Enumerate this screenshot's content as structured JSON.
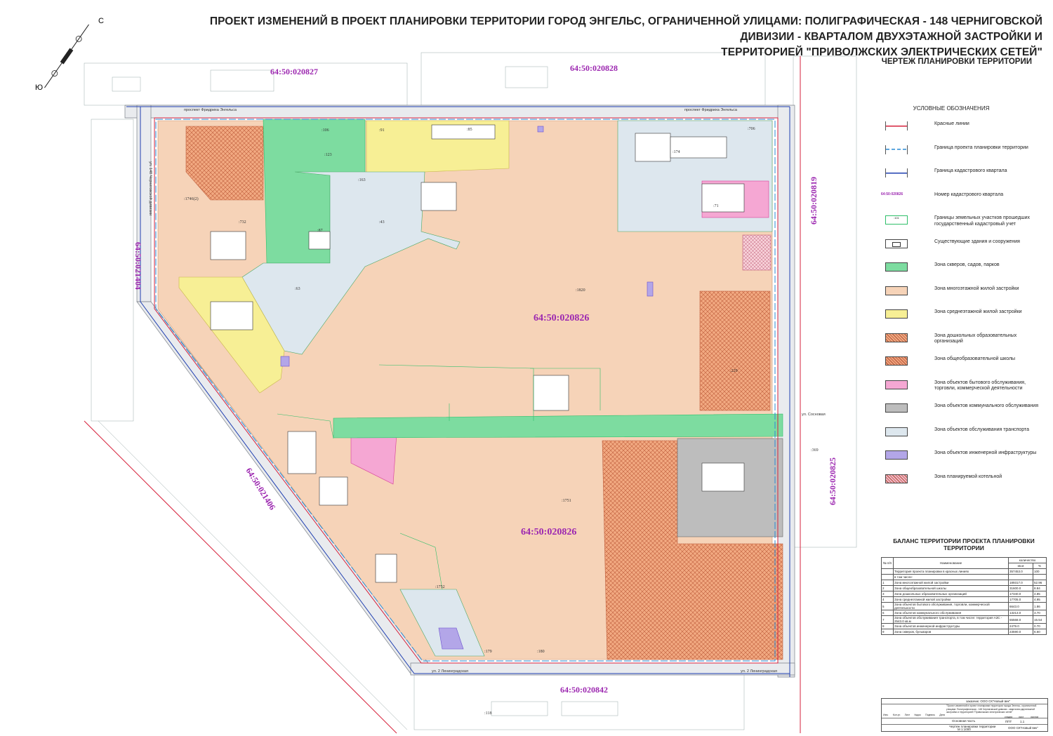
{
  "title": {
    "line1": "ПРОЕКТ ИЗМЕНЕНИЙ В ПРОЕКТ ПЛАНИРОВКИ ТЕРРИТОРИИ ГОРОД ЭНГЕЛЬС, ОГРАНИЧЕННОЙ УЛИЦАМИ: ПОЛИГРАФИЧЕСКАЯ - 148 ЧЕРНИГОВСКОЙ ДИВИЗИИ - КВАРТАЛОМ ДВУХЭТАЖНОЙ ЗАСТРОЙКИ И",
    "line2": "ТЕРРИТОРИЕЙ \"ПРИВОЛЖСКИХ ЭЛЕКТРИЧЕСКИХ СЕТЕЙ\"",
    "subtitle": "ЧЕРТЕЖ ПЛАНИРОВКИ ТЕРРИТОРИИ"
  },
  "compass": {
    "north": "С",
    "south": "Ю"
  },
  "colors": {
    "red_line": "#d6223c",
    "project_boundary": "#2a8bd4",
    "cadastral_boundary": "#1f3fb0",
    "cadastral_number": "#9c27b0",
    "green_zone": "#7ddca0",
    "multistorey": "#f6d3b8",
    "midrise": "#f7ef95",
    "preschool": "#f2a981",
    "school": "#f0a07a",
    "commercial": "#f5a7d3",
    "communal": "#bdbdbd",
    "transport": "#dde7ee",
    "engineering": "#b3a6e8",
    "boiler": "#f3b4c6"
  },
  "cadastral_labels": {
    "center_north": "64:50:020826",
    "center_south": "64:50:020826",
    "top_left": "64:50:020827",
    "top_right": "64:50:020828",
    "left": "64:50:021404",
    "right_top": "64:50:020819",
    "right_bottom": "64:50:020825",
    "bottom": "64:50:020842",
    "diagonal": "64:50:021406"
  },
  "parcel_labels": {
    "p1820": ":1820",
    "p1751": ":1751",
    "p1752": ":1752",
    "p1746": ":1746(2)",
    "p106": ":106",
    "p123": ":123",
    "p91": ":91",
    "p85": ":85",
    "p706": ":706",
    "p174": ":174",
    "p71": ":71",
    "p163": ":163",
    "p43": ":43",
    "p87": ":87",
    "p732": ":732",
    "p229": ":229",
    "p369": ":369",
    "p118": ":118",
    "p180": ":180",
    "p179": ":179",
    "p63": ":63"
  },
  "streets": {
    "top": "проспект Фридриха Энгельса",
    "bottom": "ул. 2 Ленинградская",
    "left": "ул. 148 Черниговской дивизии",
    "right": "ул. Сосновая"
  },
  "legend": {
    "heading": "УСЛОВНЫЕ ОБОЗНАЧЕНИЯ",
    "sample_cadastral": "64:50:020826",
    "sample_parcel": ":101",
    "items": [
      {
        "label": "Красные  линии",
        "type": "line",
        "color": "#d6223c"
      },
      {
        "label": "Граница проекта планировки территории",
        "type": "dash",
        "color": "#2a8bd4"
      },
      {
        "label": "Граница кадастрового квартала",
        "type": "line",
        "color": "#1f3fb0"
      },
      {
        "label": "Номер кадастрового квартала",
        "type": "text",
        "color": "#9c27b0"
      },
      {
        "label": "Границы земельных участков прошедших государственный кадастровый учет",
        "type": "parcel",
        "color": "#2fbf6a"
      },
      {
        "label": "Существующие здания и сооружения",
        "type": "building",
        "color": "#ffffff"
      },
      {
        "label": "Зона скверов, садов, парков",
        "type": "fill",
        "color": "#7ddca0"
      },
      {
        "label": "Зона многоэтажной жилой застройки",
        "type": "fill",
        "color": "#f6d3b8"
      },
      {
        "label": "Зона среднеэтажной жилой застройки",
        "type": "fill",
        "color": "#f7ef95"
      },
      {
        "label": "Зона дошкольных образовательных организаций",
        "type": "hatch",
        "color": "#f2a981"
      },
      {
        "label": "Зона общеобразовательной школы",
        "type": "hatch",
        "color": "#f0a07a"
      },
      {
        "label": "Зона объектов бытового обслуживания, торговли, коммерческой деятельности",
        "type": "fill",
        "color": "#f5a7d3"
      },
      {
        "label": "Зона объектов коммунального обслуживания",
        "type": "fill",
        "color": "#bdbdbd"
      },
      {
        "label": "Зона объектов обслуживания транспорта",
        "type": "fill",
        "color": "#dde7ee"
      },
      {
        "label": "Зона объектов инженерной инфраструктуры",
        "type": "fill",
        "color": "#b3a6e8"
      },
      {
        "label": "Зона планируемой котельной",
        "type": "hatch",
        "color": "#f3b4c6"
      }
    ]
  },
  "balance": {
    "title": "БАЛАНС ТЕРРИТОРИИ ПРОЕКТА ПЛАНИРОВКИ ТЕРРИТОРИИ",
    "headers": {
      "num": "№ п/п",
      "name": "Наименование",
      "qty": "количество",
      "unit1": "кв.м",
      "unit2": "%"
    },
    "total": {
      "name": "Территория проекта планировки в красных линиях",
      "area": "357453.0",
      "pct": "100"
    },
    "sub": "в том числе:",
    "rows": [
      {
        "n": "1",
        "name": "Зона многоэтажной жилой застройки",
        "area": "189317.0",
        "pct": "52.96"
      },
      {
        "n": "2",
        "name": "Зона общеобразовательной школы",
        "area": "31600.0",
        "pct": "8.84"
      },
      {
        "n": "3",
        "name": "Зона дошкольных образовательных организаций",
        "area": "17340.0",
        "pct": "4.85"
      },
      {
        "n": "4",
        "name": "Зона среднеэтажной жилой застройки",
        "area": "17705.0",
        "pct": "4.95"
      },
      {
        "n": "5",
        "name": "Зона объектов бытового обслуживания, торговли, коммерческой деятельности",
        "area": "6643.0",
        "pct": "1.86"
      },
      {
        "n": "6",
        "name": "Зона объектов коммунального обслуживания",
        "area": "13213.0",
        "pct": "3.70"
      },
      {
        "n": "7",
        "name": "Зона объектов обслуживания транспорта, в том числе: территория АЗС - 2543.0 кв.м",
        "area": "55568.0",
        "pct": "15.54"
      },
      {
        "n": "8",
        "name": "Зона объектов инженерной инфраструктуры",
        "area": "2479.0",
        "pct": "0.70"
      },
      {
        "n": "9",
        "name": "Зона скверов, бульваров",
        "area": "23590.0",
        "pct": "6.60"
      }
    ]
  },
  "stamp": {
    "client": "заказчик: ООО СК\"Новый век\"",
    "project": "\"Проект изменений в проект планировки территории города Энгельс, ограниченной улицами: Полиграфическая - 148 Черниговской дивизии - кварталом двухэтажной застройки и территорией \"Приволжских электрических сетей\"",
    "part": "Основная часть",
    "stage_h": "стадия",
    "sheet_h": "лист",
    "sheets_h": "листов",
    "stage": "ППТ",
    "sheet": "1.1",
    "drawing": "Чертеж планировки территории",
    "scale": "М 1:1000",
    "org": "ООО СК\"Новый век\"",
    "cols": [
      "Изм.",
      "Кол.уч",
      "Лист",
      "№док",
      "Подпись",
      "Дата"
    ]
  }
}
